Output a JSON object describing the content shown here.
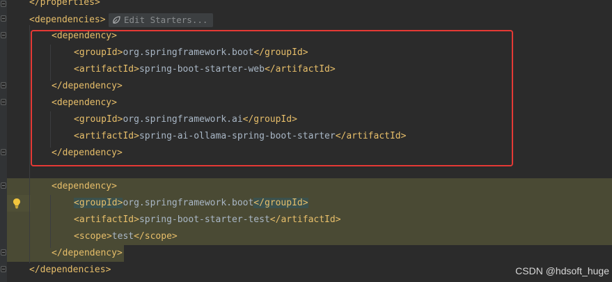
{
  "editor": {
    "lines": [
      {
        "open": "</",
        "tag": "properties",
        "close": ">",
        "text": ""
      },
      {
        "open": "<",
        "tag": "dependencies",
        "close": ">",
        "text": ""
      },
      {
        "open": "<",
        "tag": "dependency",
        "close": ">",
        "text": ""
      },
      {
        "open": "<",
        "tag": "groupId",
        "close": ">",
        "text": "org.springframework.boot",
        "end": "groupId"
      },
      {
        "open": "<",
        "tag": "artifactId",
        "close": ">",
        "text": "spring-boot-starter-web",
        "end": "artifactId"
      },
      {
        "open": "</",
        "tag": "dependency",
        "close": ">",
        "text": ""
      },
      {
        "open": "<",
        "tag": "dependency",
        "close": ">",
        "text": ""
      },
      {
        "open": "<",
        "tag": "groupId",
        "close": ">",
        "text": "org.springframework.ai",
        "end": "groupId"
      },
      {
        "open": "<",
        "tag": "artifactId",
        "close": ">",
        "text": "spring-ai-ollama-spring-boot-starter",
        "end": "artifactId"
      },
      {
        "open": "</",
        "tag": "dependency",
        "close": ">",
        "text": ""
      },
      {
        "open": "<",
        "tag": "dependency",
        "close": ">",
        "text": ""
      },
      {
        "open": "<",
        "tag": "groupId",
        "close": ">",
        "text": "org.springframework.boot",
        "end": "groupId"
      },
      {
        "open": "<",
        "tag": "artifactId",
        "close": ">",
        "text": "spring-boot-starter-test",
        "end": "artifactId"
      },
      {
        "open": "<",
        "tag": "scope",
        "close": ">",
        "text": "test",
        "end": "scope"
      },
      {
        "open": "</",
        "tag": "dependency",
        "close": ">",
        "text": ""
      },
      {
        "open": "</",
        "tag": "dependencies",
        "close": ">",
        "text": ""
      }
    ]
  },
  "inlay": {
    "edit_starters_label": "Edit Starters..."
  },
  "icons": {
    "starters": "spring-leaf-icon",
    "intention": "lightbulb-icon"
  },
  "colors": {
    "background": "#2b2b2b",
    "tag": "#e8bf6a",
    "text": "#a9b7c6",
    "highlight": "#4a4a34",
    "annotation_box": "#e53935"
  },
  "watermark": {
    "text": "CSDN @hdsoft_huge"
  }
}
